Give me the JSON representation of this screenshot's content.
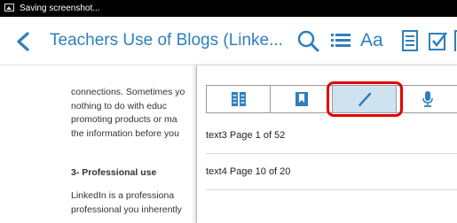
{
  "status_bar": {
    "text": "Saving screenshot..."
  },
  "header": {
    "title": "Teachers Use of Blogs (Linke...",
    "font_button": "Aa"
  },
  "content": {
    "para1": [
      "connections. Sometimes yo",
      "nothing to do with educ",
      "promoting products or ma",
      "the information before you"
    ],
    "heading": "3- Professional use",
    "para2": [
      "LinkedIn is a professiona",
      "professional you inherently"
    ]
  },
  "popup": {
    "tabs": [
      {
        "icon": "book-columns-icon"
      },
      {
        "icon": "bookmark-icon"
      },
      {
        "icon": "highlighter-icon",
        "selected": true
      },
      {
        "icon": "microphone-icon"
      }
    ],
    "items": [
      "text3 Page 1 of 52",
      "text4 Page 10 of 20"
    ]
  },
  "colors": {
    "accent": "#2e7fbe",
    "selected_tab": "#cfe3ef",
    "highlight_box": "#e30000"
  }
}
